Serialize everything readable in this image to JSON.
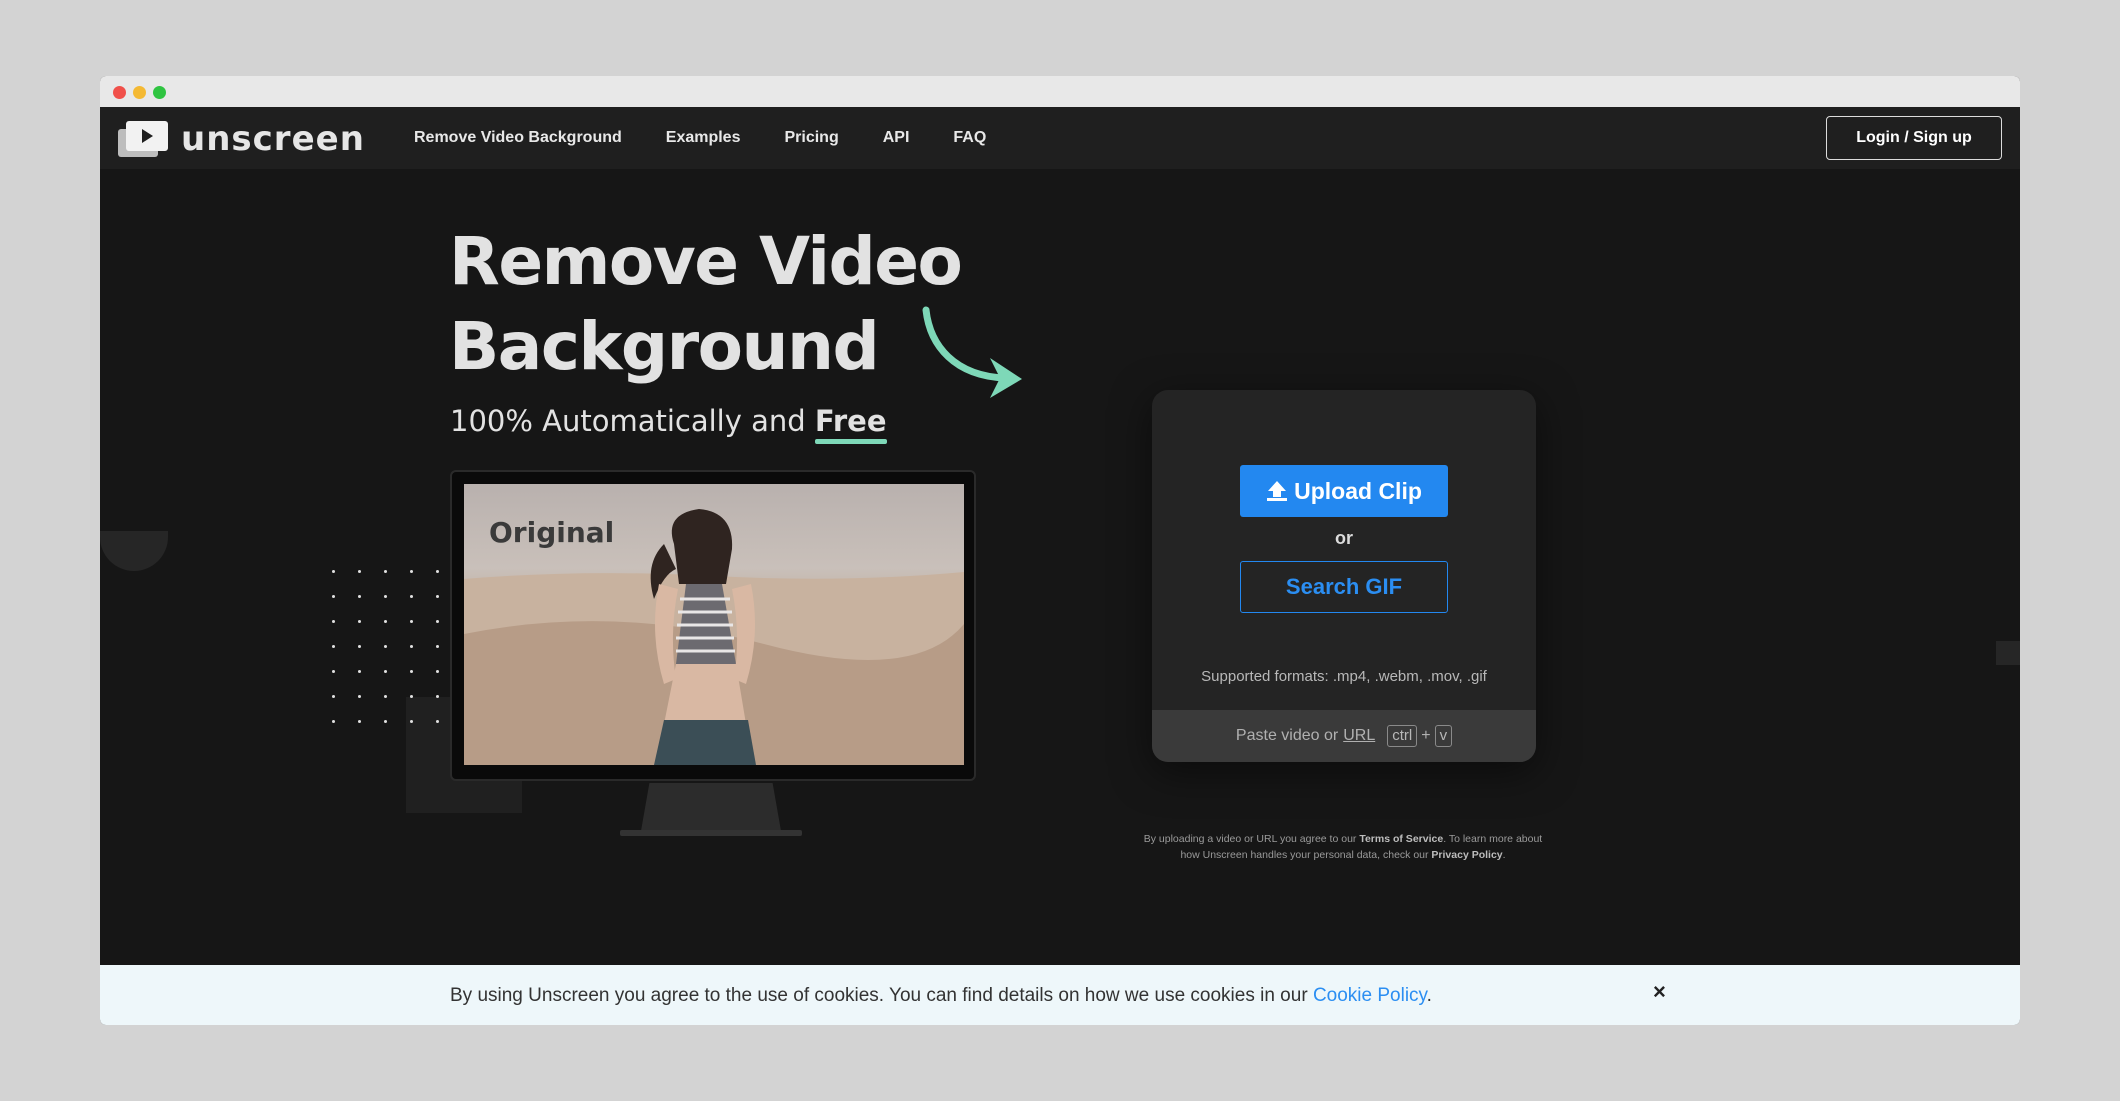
{
  "nav": {
    "logo_text": "unscreen",
    "links": [
      "Remove Video Background",
      "Examples",
      "Pricing",
      "API",
      "FAQ"
    ],
    "login_label": "Login / Sign up"
  },
  "hero": {
    "title_line1": "Remove Video",
    "title_line2": "Background",
    "subtitle_prefix": "100% Automatically and ",
    "subtitle_emphasis": "Free",
    "preview_label": "Original"
  },
  "upload": {
    "upload_label": "Upload Clip",
    "or_label": "or",
    "gif_label": "Search GIF",
    "formats_text": "Supported formats: .mp4, .webm, .mov, .gif",
    "paste_prefix": "Paste video or",
    "paste_url": "URL",
    "key_ctrl": "ctrl",
    "key_plus": "+",
    "key_v": "v"
  },
  "legal": {
    "part1": "By uploading a video or URL you agree to our ",
    "tos": "Terms of Service",
    "part2": ". To learn more about how Unscreen handles your personal data, check our ",
    "privacy": "Privacy Policy",
    "part3": "."
  },
  "cookie": {
    "text": "By using Unscreen you agree to the use of cookies. You can find details on how we use cookies in our ",
    "link": "Cookie Policy",
    "suffix": ".",
    "close_symbol": "×"
  },
  "colors": {
    "accent_blue": "#2388f0",
    "accent_green": "#7ed8b8",
    "background": "#161616"
  }
}
